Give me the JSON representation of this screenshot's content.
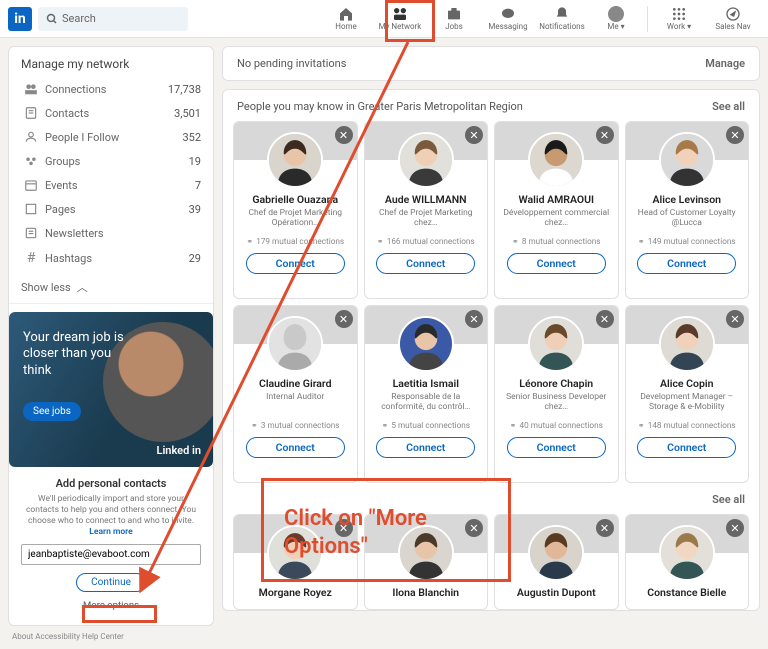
{
  "header": {
    "search_placeholder": "Search",
    "nav": {
      "home": "Home",
      "my_network": "My Network",
      "jobs": "Jobs",
      "messaging": "Messaging",
      "notifications": "Notifications",
      "me": "Me ▾",
      "work": "Work ▾",
      "sales_nav": "Sales Nav"
    }
  },
  "manage": {
    "title": "Manage my network",
    "items": [
      {
        "label": "Connections",
        "count": "17,738"
      },
      {
        "label": "Contacts",
        "count": "3,501"
      },
      {
        "label": "People I Follow",
        "count": "352"
      },
      {
        "label": "Groups",
        "count": "19"
      },
      {
        "label": "Events",
        "count": "7"
      },
      {
        "label": "Pages",
        "count": "39"
      },
      {
        "label": "Newsletters",
        "count": ""
      },
      {
        "label": "Hashtags",
        "count": "29"
      }
    ],
    "show_less": "Show less"
  },
  "promo": {
    "line": "Your dream job is closer than you think",
    "cta": "See jobs",
    "brand": "Linked in"
  },
  "add_contacts": {
    "title": "Add personal contacts",
    "desc": "We'll periodically import and store your contacts to help you and others connect. You choose who to connect to and who to invite. ",
    "learn_more": "Learn more",
    "email": "jeanbaptiste@evaboot.com",
    "continue": "Continue",
    "more_options": "More options"
  },
  "invitations": {
    "text": "No pending invitations",
    "manage": "Manage"
  },
  "pymk": {
    "title": "People you may know in Greater Paris Metropolitan Region",
    "see_all": "See all",
    "connect_label": "Connect",
    "cards": [
      {
        "name": "Gabrielle Ouazana",
        "role": "Chef de Projet Marketing Opérationn…",
        "mutual": "179 mutual connections"
      },
      {
        "name": "Aude WILLMANN",
        "role": "Chef de Projet Marketing chez…",
        "mutual": "166 mutual connections"
      },
      {
        "name": "Walid AMRAOUI",
        "role": "Développement commercial chez…",
        "mutual": "8 mutual connections"
      },
      {
        "name": "Alice Levinson",
        "role": "Head of Customer Loyalty @Lucca",
        "mutual": "149 mutual connections"
      },
      {
        "name": "Claudine Girard",
        "role": "Internal Auditor",
        "mutual": "3 mutual connections"
      },
      {
        "name": "Laetitia Ismail",
        "role": "Responsable de la conformité, du contrôl…",
        "mutual": "5 mutual connections"
      },
      {
        "name": "Léonore Chapin",
        "role": "Senior Business Developer chez…",
        "mutual": "40 mutual connections"
      },
      {
        "name": "Alice Copin",
        "role": "Development Manager – Storage & e-Mobility",
        "mutual": "148 mutual connections"
      }
    ],
    "row3_see_all": "See all",
    "row3_names": [
      "Morgane Royez",
      "Ilona Blanchin",
      "Augustin Dupont",
      "Constance Bielle"
    ]
  },
  "annotation": {
    "callout_text": "Click on \"More Options\""
  },
  "footer": "About   Accessibility   Help Center"
}
